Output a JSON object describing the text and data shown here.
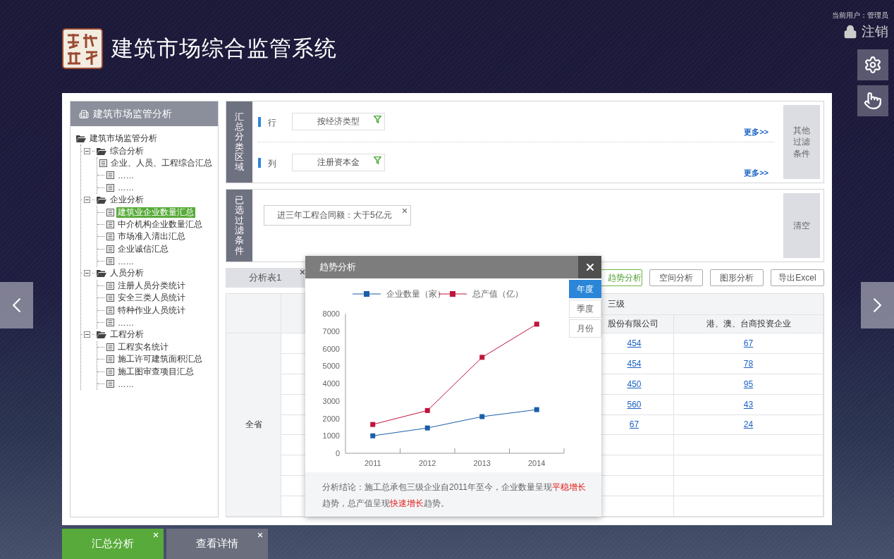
{
  "header": {
    "title": "建筑市场综合监管系统"
  },
  "user": {
    "label": "当前用户：管理员",
    "logout": "注销"
  },
  "sidebar": {
    "title": "建筑市场监管分析",
    "tree": {
      "label": "建筑市场监管分析",
      "children": [
        {
          "label": "综合分析",
          "expanded": true,
          "selected": false,
          "children": [
            {
              "label": "企业、人员、工程综合汇总",
              "selected": false
            },
            {
              "label": "……",
              "selected": false
            },
            {
              "label": "……",
              "selected": false
            }
          ]
        },
        {
          "label": "企业分析",
          "expanded": true,
          "selected": false,
          "children": [
            {
              "label": "建筑业企业数量汇总",
              "selected": true
            },
            {
              "label": "中介机构企业数量汇总",
              "selected": false
            },
            {
              "label": "市场准入清出汇总",
              "selected": false
            },
            {
              "label": "企业诚信汇总",
              "selected": false
            },
            {
              "label": "……",
              "selected": false
            }
          ]
        },
        {
          "label": "人员分析",
          "expanded": true,
          "selected": false,
          "children": [
            {
              "label": "注册人员分类统计",
              "selected": false
            },
            {
              "label": "安全三类人员统计",
              "selected": false
            },
            {
              "label": "特种作业人员统计",
              "selected": false
            },
            {
              "label": "……",
              "selected": false
            }
          ]
        },
        {
          "label": "工程分析",
          "expanded": true,
          "selected": false,
          "children": [
            {
              "label": "工程实名统计",
              "selected": false
            },
            {
              "label": "施工许可建筑面积汇总",
              "selected": false
            },
            {
              "label": "施工图审查项目汇总",
              "selected": false
            },
            {
              "label": "……",
              "selected": false
            }
          ]
        }
      ]
    }
  },
  "classification": {
    "label": "汇总分类区域",
    "rows": [
      {
        "label": "行",
        "value": "按经济类型",
        "more": "更多>>"
      },
      {
        "label": "列",
        "value": "注册资本金",
        "more": "更多>>"
      }
    ],
    "side_button": "其他过滤条件"
  },
  "filters": {
    "label": "已选过滤条件",
    "tags": [
      "进三年工程合同额：大于5亿元"
    ],
    "clear_button": "清空"
  },
  "toolbar": {
    "tabs": [
      {
        "label": "分析表1",
        "selected": true
      }
    ],
    "buttons": [
      {
        "label": "趋势分析",
        "selected": true
      },
      {
        "label": "空间分析",
        "selected": false
      },
      {
        "label": "图形分析",
        "selected": false
      },
      {
        "label": "导出Excel",
        "selected": false
      }
    ]
  },
  "table": {
    "group_header": "三级",
    "columns": [
      "股份有限公司",
      "港、澳、台商投资企业"
    ],
    "region": "全省",
    "rows": [
      [
        "454",
        "67"
      ],
      [
        "454",
        "78"
      ],
      [
        "450",
        "95"
      ],
      [
        "560",
        "43"
      ],
      [
        "67",
        "24"
      ]
    ]
  },
  "modal": {
    "title": "趋势分析",
    "periods": [
      {
        "label": "年度",
        "selected": true
      },
      {
        "label": "季度",
        "selected": false
      },
      {
        "label": "月份",
        "selected": false
      }
    ],
    "chart_data": {
      "type": "line",
      "legend": "top",
      "categories": [
        "2011",
        "2012",
        "2013",
        "2014"
      ],
      "series": [
        {
          "name": "企业数量（家）",
          "color": "#1a5fa8",
          "marker": "square",
          "values": [
            1000,
            1450,
            2100,
            2500
          ]
        },
        {
          "name": "总产值（亿）",
          "color": "#c0143c",
          "marker": "square",
          "values": [
            1650,
            2450,
            5500,
            7400
          ]
        }
      ],
      "ylim": [
        0,
        8000
      ],
      "yticks": [
        0,
        1000,
        2000,
        3000,
        4000,
        5000,
        6000,
        7000,
        8000
      ]
    },
    "conclusion": "分析结论：施工总承包三级企业自2011年至今，企业数量呈现**平稳增长**趋势，总产值呈现**快速增长**趋势。"
  },
  "bottom_tabs": [
    {
      "label": "汇总分析",
      "selected": true
    },
    {
      "label": "查看详情",
      "selected": false
    }
  ]
}
